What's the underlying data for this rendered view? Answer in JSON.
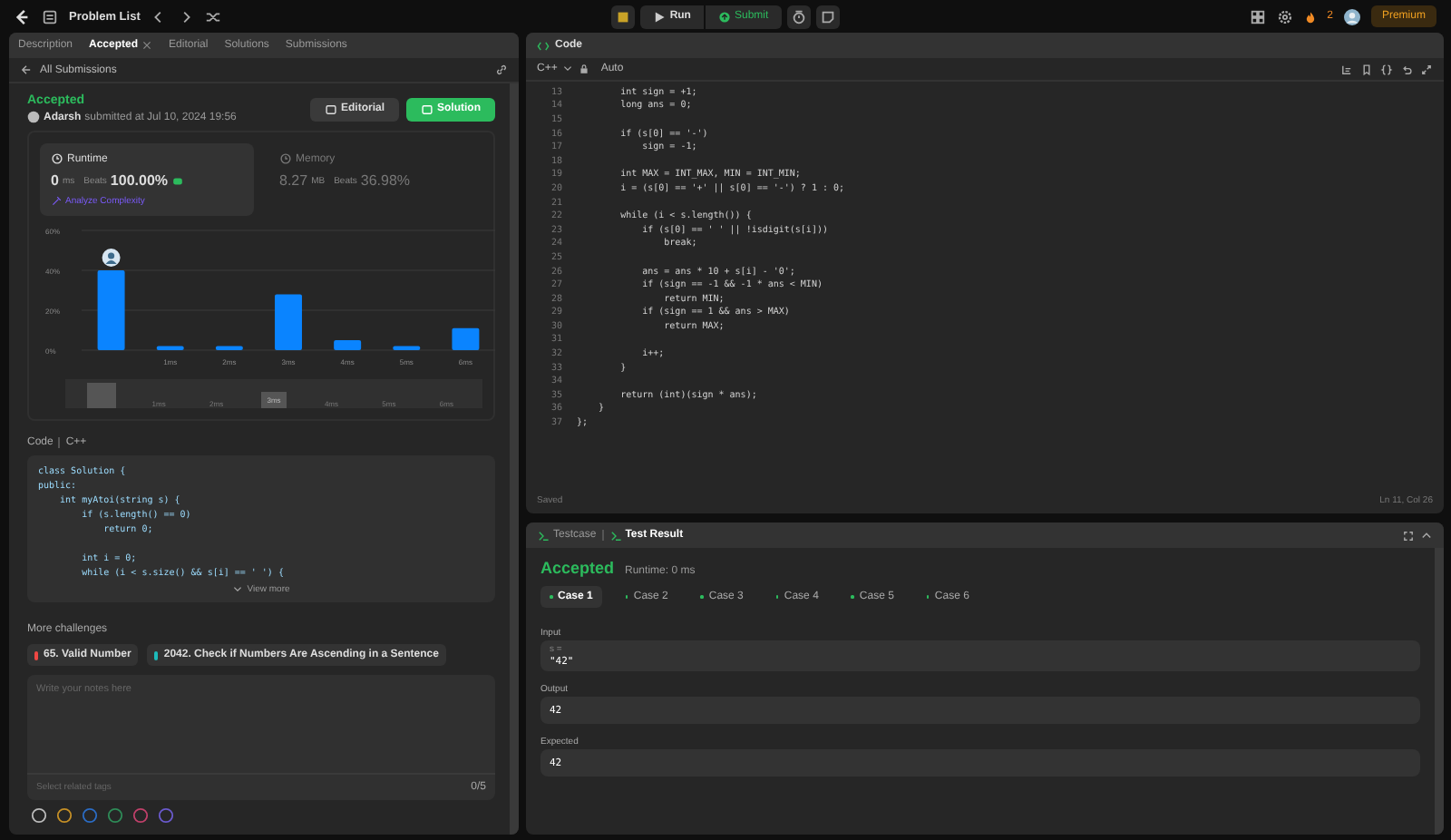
{
  "top_bar": {
    "title": "Problem List",
    "run": "Run",
    "submit": "Submit",
    "streak": "2",
    "premium": "Premium"
  },
  "left_tabs": [
    {
      "label": "Description",
      "selected": false
    },
    {
      "label": "Accepted",
      "selected": true
    },
    {
      "label": "Editorial",
      "selected": false
    },
    {
      "label": "Solutions",
      "selected": false
    },
    {
      "label": "Submissions",
      "selected": false
    }
  ],
  "back_link": "All Submissions",
  "submission": {
    "status": "Accepted",
    "user": "Adarsh",
    "submitted": "submitted at Jul 10, 2024 19:56",
    "buttons": [
      {
        "label": "Editorial",
        "kind": "secondary"
      },
      {
        "label": "Solution",
        "kind": "primary"
      }
    ]
  },
  "stats": [
    {
      "title": "Runtime",
      "value": "0",
      "unit": "ms",
      "beats_label": "Beats",
      "beats": "100.00%",
      "selected": true,
      "link": "Analyze Complexity"
    },
    {
      "title": "Memory",
      "value": "8.27",
      "unit": "MB",
      "beats_label": "Beats",
      "beats": "36.98%",
      "selected": false
    }
  ],
  "chart_data": {
    "type": "bar",
    "categories": [
      null,
      "1ms",
      "2ms",
      "3ms",
      "4ms",
      "5ms",
      "6ms"
    ],
    "values": [
      40,
      2,
      2,
      28,
      5,
      2,
      11
    ],
    "ylim": [
      0,
      60
    ],
    "yticks": [
      {
        "value": 0,
        "label": "0%"
      },
      {
        "value": 20,
        "label": "20%"
      },
      {
        "value": 40,
        "label": "40%"
      },
      {
        "value": 60,
        "label": "60%"
      }
    ]
  },
  "overview": {
    "labels": [
      "1ms",
      "2ms",
      "3ms",
      "4ms",
      "5ms",
      "6ms"
    ]
  },
  "code_section": {
    "label": "Code",
    "language": "C++",
    "view_more": "View more",
    "blocks": [
      [
        "class Solution {",
        "public:",
        "    int myAtoi(string s) {",
        "        if (s.length() == 0)",
        "            return 0;"
      ],
      [
        "        int i = 0;",
        "        while (i < s.size() && s[i] == ' ') {"
      ]
    ]
  },
  "more_challenges": {
    "title": "More challenges",
    "items": [
      {
        "label": "65. Valid Number",
        "color": "#ef4743"
      },
      {
        "label": "2042. Check if Numbers Are Ascending in a Sentence",
        "color": "#1cbaba"
      }
    ]
  },
  "notes": {
    "placeholder": "Write your notes here",
    "tags_placeholder": "Select related tags",
    "count": "0/5"
  },
  "editor": {
    "tab": "Code",
    "language": "C++",
    "mode": "Auto",
    "status": "Saved",
    "cursor": "Ln 11, Col 26",
    "lines": [
      {
        "num": "13",
        "text": "        int sign = +1;"
      },
      {
        "num": "14",
        "text": "        long ans = 0;"
      },
      {
        "num": "15"
      },
      {
        "num": "16",
        "text": "        if (s[0] == '-')"
      },
      {
        "num": "17",
        "text": "            sign = -1;"
      },
      {
        "num": "18"
      },
      {
        "num": "19",
        "text": "        int MAX = INT_MAX, MIN = INT_MIN;"
      },
      {
        "num": "20",
        "text": "        i = (s[0] == '+' || s[0] == '-') ? 1 : 0;"
      },
      {
        "num": "21"
      },
      {
        "num": "22",
        "text": "        while (i < s.length()) {"
      },
      {
        "num": "23",
        "text": "            if (s[0] == ' ' || !isdigit(s[i]))"
      },
      {
        "num": "24",
        "text": "                break;"
      },
      {
        "num": "25"
      },
      {
        "num": "26",
        "text": "            ans = ans * 10 + s[i] - '0';"
      },
      {
        "num": "27",
        "text": "            if (sign == -1 && -1 * ans < MIN)"
      },
      {
        "num": "28",
        "text": "                return MIN;"
      },
      {
        "num": "29",
        "text": "            if (sign == 1 && ans > MAX)"
      },
      {
        "num": "30",
        "text": "                return MAX;"
      },
      {
        "num": "31"
      },
      {
        "num": "32",
        "text": "            i++;"
      },
      {
        "num": "33",
        "text": "        }"
      },
      {
        "num": "34"
      },
      {
        "num": "35",
        "text": "        return (int)(sign * ans);"
      },
      {
        "num": "36",
        "text": "    }"
      },
      {
        "num": "37",
        "text": "};"
      }
    ]
  },
  "test_panel": {
    "tabs": [
      {
        "label": "Testcase",
        "selected": false
      },
      {
        "label": "Test Result",
        "selected": true
      }
    ],
    "status": "Accepted",
    "runtime": "Runtime: 0 ms",
    "cases": [
      {
        "label": "Case 1",
        "selected": true
      },
      {
        "label": "Case 2",
        "selected": false
      },
      {
        "label": "Case 3",
        "selected": false
      },
      {
        "label": "Case 4",
        "selected": false
      },
      {
        "label": "Case 5",
        "selected": false
      },
      {
        "label": "Case 6",
        "selected": false
      }
    ],
    "sections": [
      {
        "label": "Input",
        "var": "s =",
        "value": "\"42\""
      },
      {
        "label": "Output",
        "value": "42"
      },
      {
        "label": "Expected",
        "value": "42"
      }
    ]
  }
}
